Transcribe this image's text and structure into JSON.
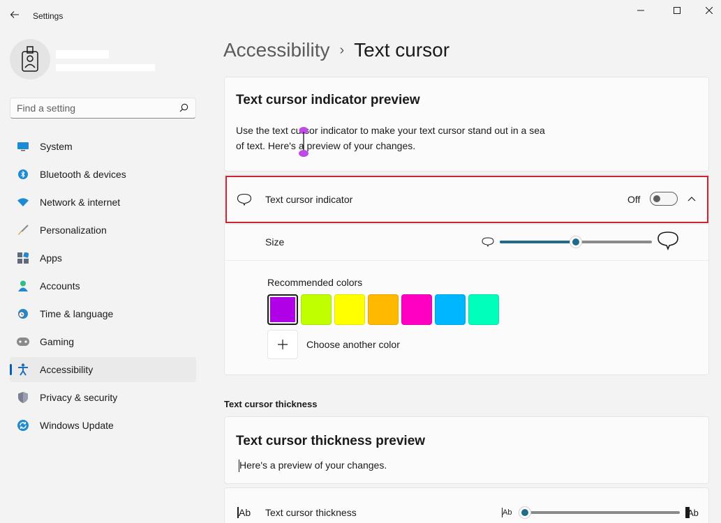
{
  "window": {
    "title": "Settings"
  },
  "search": {
    "placeholder": "Find a setting"
  },
  "sidebar": {
    "items": [
      {
        "label": "System",
        "icon": "monitor-icon",
        "active": false
      },
      {
        "label": "Bluetooth & devices",
        "icon": "bluetooth-icon",
        "active": false
      },
      {
        "label": "Network & internet",
        "icon": "wifi-icon",
        "active": false
      },
      {
        "label": "Personalization",
        "icon": "brush-icon",
        "active": false
      },
      {
        "label": "Apps",
        "icon": "apps-icon",
        "active": false
      },
      {
        "label": "Accounts",
        "icon": "person-icon",
        "active": false
      },
      {
        "label": "Time & language",
        "icon": "globe-clock-icon",
        "active": false
      },
      {
        "label": "Gaming",
        "icon": "gamepad-icon",
        "active": false
      },
      {
        "label": "Accessibility",
        "icon": "accessibility-icon",
        "active": true
      },
      {
        "label": "Privacy & security",
        "icon": "shield-icon",
        "active": false
      },
      {
        "label": "Windows Update",
        "icon": "update-icon",
        "active": false
      }
    ]
  },
  "breadcrumb": {
    "parent": "Accessibility",
    "separator": "›",
    "current": "Text cursor"
  },
  "preview_card": {
    "title": "Text cursor indicator preview",
    "description_line1": "Use the text cursor indicator to make your text cursor stand out in a sea",
    "description_line2": "of text. Here's a preview of your changes."
  },
  "indicator_row": {
    "label": "Text cursor indicator",
    "state": "Off",
    "toggle_on": false
  },
  "size_row": {
    "label": "Size",
    "value_fraction": 0.5
  },
  "colors": {
    "label": "Recommended colors",
    "swatches": [
      "#b000e8",
      "#bfff00",
      "#ffff00",
      "#ffb900",
      "#ff00c3",
      "#00b7ff",
      "#00ffbb"
    ],
    "selected_index": 0,
    "custom_label": "Choose another color"
  },
  "thickness_section": {
    "heading": "Text cursor thickness",
    "preview_title": "Text cursor thickness preview",
    "preview_text": "Here's a preview of your changes.",
    "row_label": "Text cursor thickness",
    "small_glyph": "Ab",
    "large_glyph": "Ab",
    "value_fraction": 0.0
  },
  "accent_color": "#005fb8",
  "indicator_color": "#b000e8"
}
